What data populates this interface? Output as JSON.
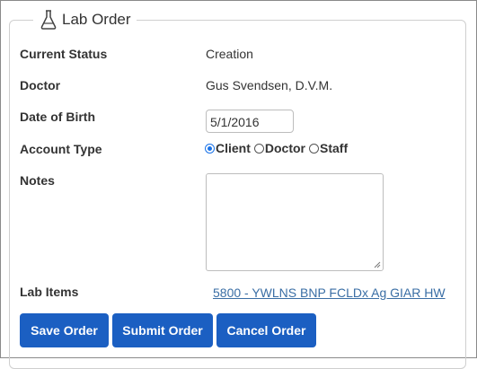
{
  "legend": {
    "icon": "flask-icon",
    "title": "Lab Order"
  },
  "fields": {
    "current_status": {
      "label": "Current Status",
      "value": "Creation"
    },
    "doctor": {
      "label": "Doctor",
      "value": "Gus Svendsen, D.V.M."
    },
    "dob": {
      "label": "Date of Birth",
      "value": "5/1/2016"
    },
    "account_type": {
      "label": "Account Type",
      "options": [
        "Client",
        "Doctor",
        "Staff"
      ],
      "selected": "Client"
    },
    "notes": {
      "label": "Notes",
      "value": ""
    },
    "lab_items": {
      "label": "Lab Items",
      "link": "5800 - YWLNS BNP FCLDx Ag GIAR HW"
    }
  },
  "buttons": {
    "save": "Save Order",
    "submit": "Submit Order",
    "cancel": "Cancel Order"
  },
  "colors": {
    "primary_button": "#1b5fc2",
    "link": "#3a6ea5",
    "radio_selected": "#1a73e8"
  }
}
